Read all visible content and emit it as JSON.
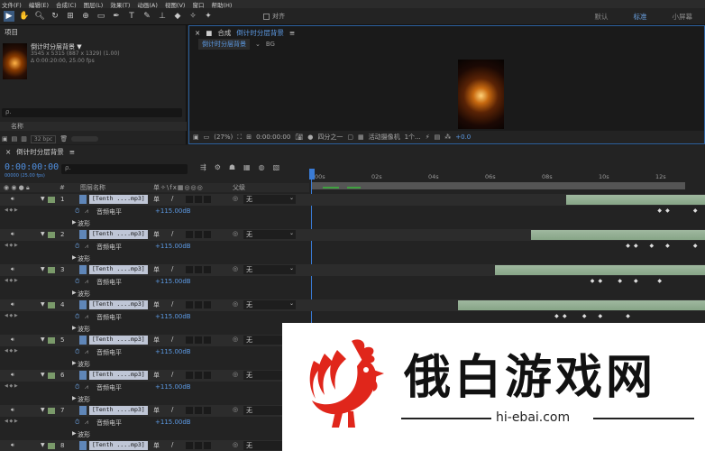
{
  "menu": [
    "文件(F)",
    "编辑(E)",
    "合成(C)",
    "图层(L)",
    "效果(T)",
    "动画(A)",
    "视图(V)",
    "窗口",
    "帮助(H)"
  ],
  "toolbar": {
    "align_label": "对齐",
    "workspaces": [
      "默认",
      "标准",
      "小屏幕"
    ],
    "active_workspace": "标准"
  },
  "project": {
    "title": "项目",
    "item_name": "倒计时分层背景 ▼",
    "item_dims": "3545 x 5315 (887 x 1329) (1.00)",
    "item_duration": "Δ 0:00:20:00, 25.00 fps",
    "search_placeholder": "ρ.",
    "column_name": "名称",
    "bpc": "32 bpc"
  },
  "composition": {
    "title_prefix": "合成",
    "name": "倒计时分层背景",
    "tab_name": "倒计时分层背景",
    "bg_label": "BG",
    "zoom": "(27%)",
    "timecode": "0:00:00:00",
    "resolution": "四分之一",
    "camera": "活动摄像机",
    "views": "1个...",
    "exposure": "+0.0"
  },
  "timeline": {
    "tab_name": "倒计时分层背景",
    "timecode": "0:00:00:00",
    "timecode_sub": "00000 (25.00 fps)",
    "search_placeholder": "ρ.",
    "col_num": "#",
    "col_name": "图层名称",
    "col_switches": "单✧\\fx▦◎◎◎",
    "col_parent": "父级",
    "ruler_ticks": [
      "00s",
      "02s",
      "04s",
      "06s",
      "08s",
      "10s",
      "12s"
    ],
    "layers": [
      {
        "num": "1",
        "name": "[Tenth ....mp3]",
        "parent": "无",
        "prop": "音频电平",
        "value": "+115.00dB",
        "wave": "波形",
        "bar_start": 0.65,
        "keys": [
          0.88,
          0.9,
          0.97,
          1.0
        ]
      },
      {
        "num": "2",
        "name": "[Tenth ....mp3]",
        "parent": "无",
        "prop": "音频电平",
        "value": "+115.00dB",
        "wave": "波形",
        "bar_start": 0.56,
        "keys": [
          0.8,
          0.82,
          0.86,
          0.9,
          0.97
        ]
      },
      {
        "num": "3",
        "name": "[Tenth ....mp3]",
        "parent": "无",
        "prop": "音频电平",
        "value": "+115.00dB",
        "wave": "波形",
        "bar_start": 0.47,
        "keys": [
          0.71,
          0.73,
          0.78,
          0.82,
          0.88
        ]
      },
      {
        "num": "4",
        "name": "[Tenth ....mp3]",
        "parent": "无",
        "prop": "音频电平",
        "value": "+115.00dB",
        "wave": "波形",
        "bar_start": 0.375,
        "keys": [
          0.62,
          0.64,
          0.69,
          0.73,
          0.8
        ]
      },
      {
        "num": "5",
        "name": "[Tenth ....mp3]",
        "parent": "无",
        "prop": "音频电平",
        "value": "+115.00dB",
        "wave": "波形"
      },
      {
        "num": "6",
        "name": "[Tenth ....mp3]",
        "parent": "无",
        "prop": "音频电平",
        "value": "+115.00dB",
        "wave": "波形"
      },
      {
        "num": "7",
        "name": "[Tenth ....mp3]",
        "parent": "无",
        "prop": "音频电平",
        "value": "+115.00dB",
        "wave": "波形"
      },
      {
        "num": "8",
        "name": "[Tenth ....mp3]",
        "parent": "无"
      }
    ]
  },
  "watermark": {
    "title": "俄白游戏网",
    "url": "hi-ebai.com",
    "accent": "#e0261b"
  }
}
